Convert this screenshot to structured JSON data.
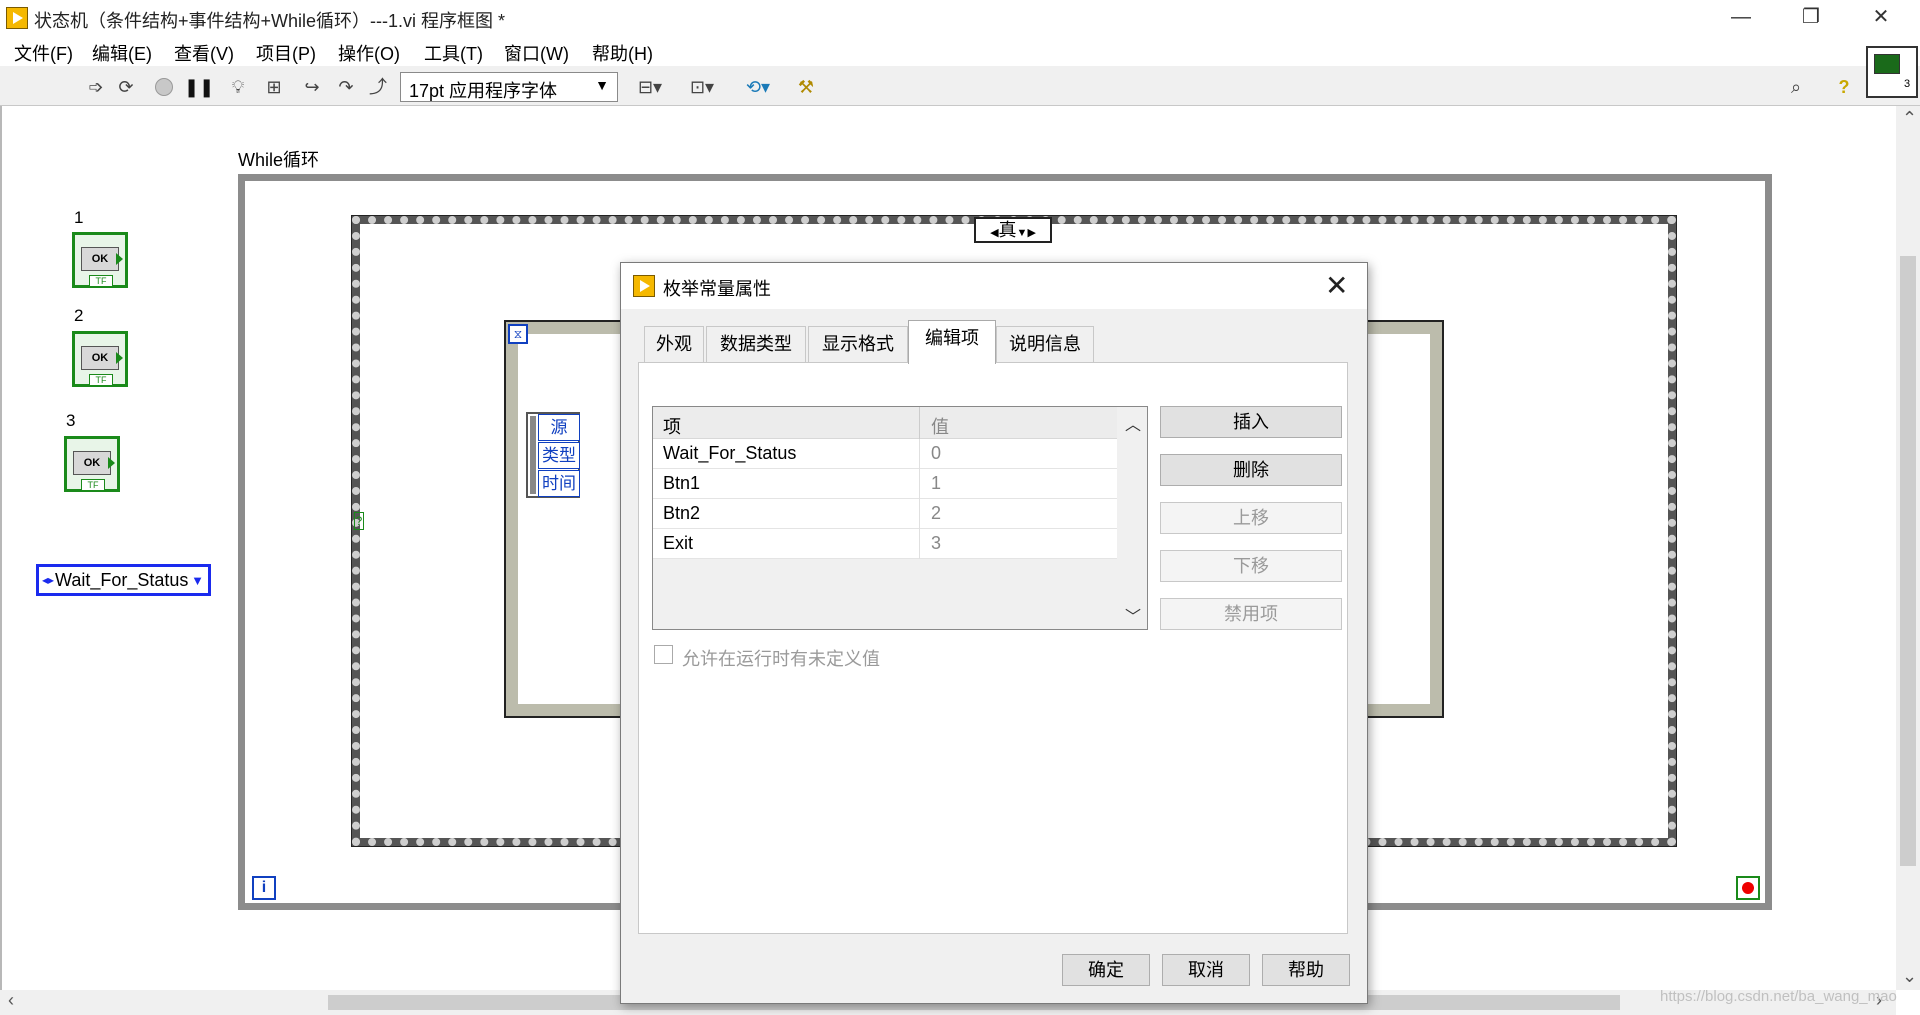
{
  "window": {
    "title": "状态机（条件结构+事件结构+While循环）---1.vi 程序框图 *",
    "minimize": "—",
    "restore": "❐",
    "close": "✕"
  },
  "menu": [
    "文件(F)",
    "编辑(E)",
    "查看(V)",
    "项目(P)",
    "操作(O)",
    "工具(T)",
    "窗口(W)",
    "帮助(H)"
  ],
  "toolbar": {
    "font": "17pt 应用程序字体",
    "icons": [
      "run-arrow-icon",
      "run-continuously-icon",
      "abort-icon",
      "pause-icon",
      "highlight-bulb-icon",
      "retain-wire-values-icon",
      "step-into-icon",
      "step-over-icon",
      "step-out-icon",
      "align-icon",
      "distribute-icon",
      "reorder-icon",
      "cleanup-icon",
      "search-icon",
      "help-icon"
    ]
  },
  "diagram": {
    "while_label": "While循环",
    "iteration_terminal": "i",
    "case_selector": "真",
    "case_selector_terminal": "?",
    "event_timeout": "⧖",
    "event_fields": [
      "源",
      "类型",
      "时间"
    ],
    "buttons": [
      {
        "label": "1",
        "text": "OK",
        "type": "TF"
      },
      {
        "label": "2",
        "text": "OK",
        "type": "TF"
      },
      {
        "label": "3",
        "text": "OK",
        "type": "TF"
      }
    ],
    "enum_constant": "Wait_For_Status"
  },
  "dialog": {
    "title": "枚举常量属性",
    "close": "✕",
    "tabs": [
      "外观",
      "数据类型",
      "显示格式",
      "编辑项",
      "说明信息"
    ],
    "active_tab": "编辑项",
    "table": {
      "headers": [
        "项",
        "值"
      ],
      "rows": [
        {
          "item": "Wait_For_Status",
          "value": "0"
        },
        {
          "item": "Btn1",
          "value": "1"
        },
        {
          "item": "Btn2",
          "value": "2"
        },
        {
          "item": "Exit",
          "value": "3"
        }
      ]
    },
    "side_buttons": [
      {
        "label": "插入",
        "enabled": true
      },
      {
        "label": "删除",
        "enabled": true
      },
      {
        "label": "上移",
        "enabled": false
      },
      {
        "label": "下移",
        "enabled": false
      },
      {
        "label": "禁用项",
        "enabled": false
      }
    ],
    "checkbox_label": "允许在运行时有未定义值",
    "checkbox_checked": false,
    "footer_buttons": [
      "确定",
      "取消",
      "帮助"
    ]
  },
  "watermark": "https://blog.csdn.net/ba_wang_mao",
  "colors": {
    "accent_blue": "#1a2aee",
    "boolean_green": "#1a8a1a",
    "app_icon": "#f5b800"
  }
}
